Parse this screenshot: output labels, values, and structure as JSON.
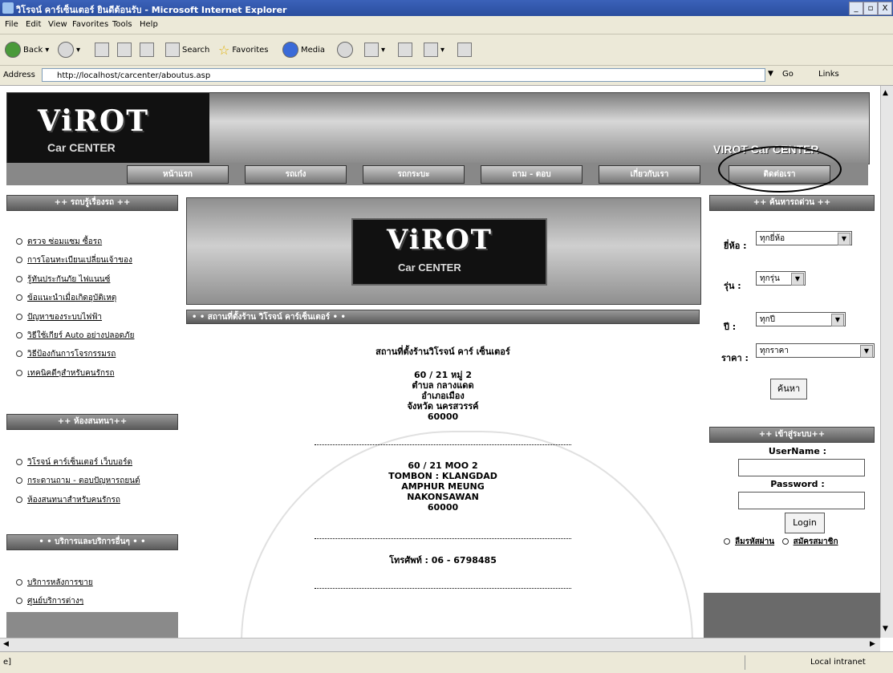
{
  "window": {
    "title": "วิโรจน์ คาร์เซ็นเตอร์ ยินดีต้อนรับ - Microsoft Internet Explorer",
    "controls": [
      "_",
      "▫",
      "X"
    ]
  },
  "menu": [
    "File",
    "Edit",
    "View",
    "Favorites",
    "Tools",
    "Help"
  ],
  "toolbar": {
    "back": "Back",
    "search": "Search",
    "favorites": "Favorites",
    "media": "Media"
  },
  "address": {
    "label": "Address",
    "url": "http://localhost/carcenter/aboutus.asp",
    "go": "Go",
    "links": "Links"
  },
  "banner": {
    "logo_main": "ViROT",
    "logo_sub": "Car CENTER",
    "right_text": "VIROT Car CENTER"
  },
  "nav": [
    "หน้าแรก",
    "รถเก๋ง",
    "รถกระบะ",
    "ถาม - ตอบ",
    "เกี่ยวกับเรา",
    "ติดต่อเรา"
  ],
  "left": {
    "section1_title": "++ รถบรู้เรื่องรถ ++",
    "section1_links": [
      "ตรวจ ซ่อมแซม ซื้อรถ",
      "การโอนทะเบียนเปลี่ยนเจ้าของ",
      "รู้ทันประกันภัย ไฟแนนซ์",
      "ข้อแนะนำเมื่อเกิดอุบัติเหตุ",
      "ปัญหาของระบบไฟฟ้า",
      "วิธีใช้เกียร์ Auto อย่างปลอดภัย",
      "วิธีป้องกันการโจรกรรมรถ",
      "เทคนิคดีๆสำหรับคนรักรถ"
    ],
    "section2_title": "++ ห้องสนทนา++",
    "section2_links": [
      "วิโรจน์ คาร์เซ็นเตอร์ เว็บบอร์ด",
      "กระดานถาม - ตอบปัญหารถยนต์",
      "ห้องสนทนาสำหรับคนรักรถ"
    ],
    "section3_title": "• • บริการและบริการอื่นๆ • •",
    "section3_links": [
      "บริการหลังการขาย",
      "ศูนย์บริการต่างๆ"
    ]
  },
  "center": {
    "logo_main": "ViROT",
    "logo_sub": "Car CENTER",
    "section_title": "• • สถานที่ตั้งร้าน วิโรจน์ คาร์เซ็นเตอร์ • •",
    "heading": "สถานที่ตั้งร้านวิโรจน์ คาร์ เซ็นเตอร์",
    "thai_address": [
      "60 / 21 หมู่ 2",
      "ตำบล กลางแดด",
      "อำเภอเมือง",
      "จังหวัด นครสวรรค์",
      "60000"
    ],
    "eng_address": [
      "60 / 21 MOO 2",
      "TOMBON : KLANGDAD",
      "AMPHUR MEUNG",
      "NAKONSAWAN",
      "60000"
    ],
    "phone": "โทรศัพท์ : 06 - 6798485"
  },
  "right": {
    "search_title": "++ ค้นหารถด่วน ++",
    "brand_label": "ยี่ห้อ :",
    "brand_value": "ทุกยี่ห้อ",
    "model_label": "รุ่น :",
    "model_value": "ทุกรุ่น",
    "year_label": "ปี :",
    "year_value": "ทุกปี",
    "price_label": "ราคา :",
    "price_value": "ทุกราคา",
    "search_button": "ค้นหา",
    "login_title": "++ เข้าสู่ระบบ++",
    "username_label": "UserName :",
    "password_label": "Password :",
    "login_button": "Login",
    "forgot_link": "ลืมรหัสผ่าน",
    "register_link": "สมัครสมาชิก"
  },
  "status": {
    "text": "e]",
    "zone": "Local intranet"
  }
}
